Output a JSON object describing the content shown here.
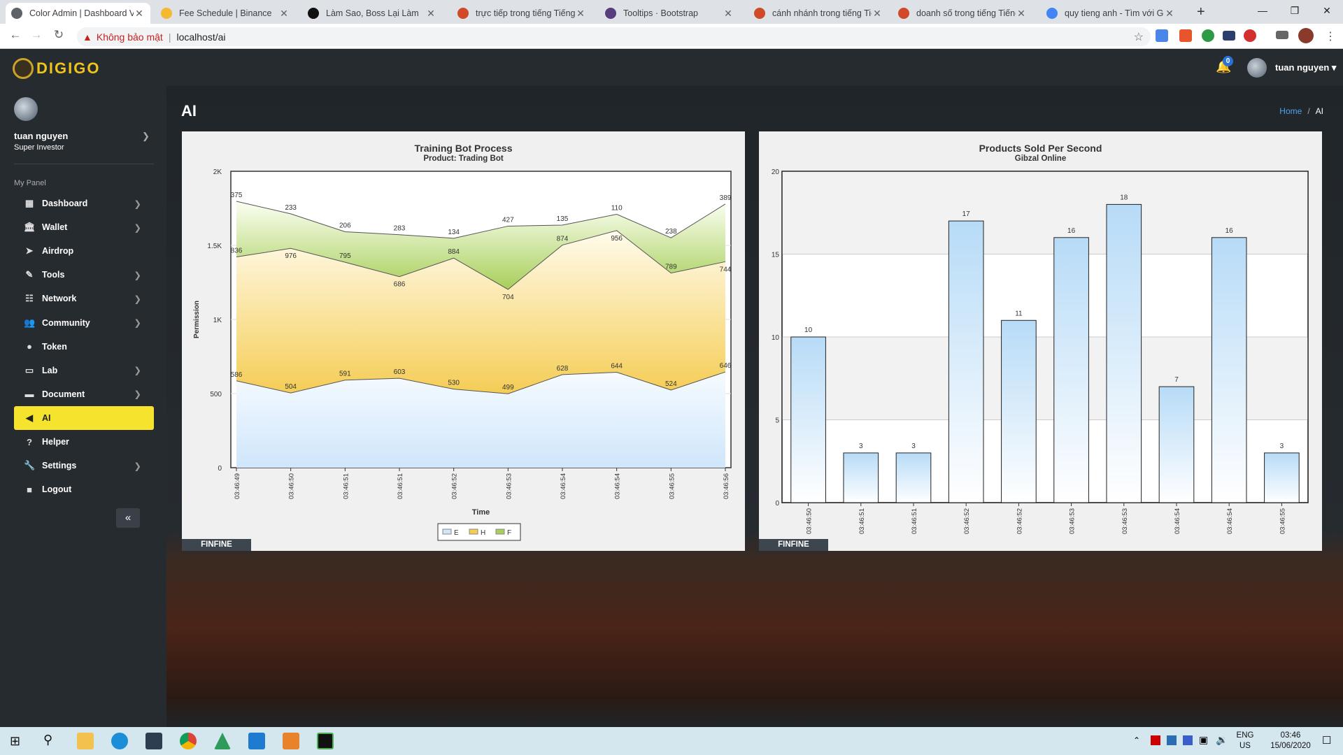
{
  "browser": {
    "tabs": [
      {
        "title": "Color Admin | Dashboard V",
        "active": true,
        "icon": "page-icon",
        "color": "#5f6368"
      },
      {
        "title": "Fee Schedule | Binance",
        "icon": "binance-icon",
        "color": "#f3ba2f"
      },
      {
        "title": "Làm Sao, Boss Lại Làm",
        "icon": "d-icon",
        "color": "#111111"
      },
      {
        "title": "trực tiếp trong tiếng Tiếng",
        "icon": "glosbe-icon",
        "color": "#d04a2a"
      },
      {
        "title": "Tooltips · Bootstrap",
        "icon": "bootstrap-icon",
        "color": "#563d7c"
      },
      {
        "title": "cánh nhánh trong tiếng Tiế",
        "icon": "glosbe-icon",
        "color": "#d04a2a"
      },
      {
        "title": "doanh số trong tiếng Tiếng",
        "icon": "glosbe-icon",
        "color": "#d04a2a"
      },
      {
        "title": "quy tieng anh - Tìm với Go",
        "icon": "google-icon",
        "color": "#4285f4"
      }
    ],
    "new_tab": "+",
    "security": "Không bảo mật",
    "url": "localhost/ai"
  },
  "app": {
    "brand": "DIGIGO",
    "notifications": "0",
    "user": "tuan nguyen ▾"
  },
  "sidebar": {
    "user_name": "tuan nguyen",
    "user_role": "Super Investor",
    "panel_label": "My Panel",
    "items": [
      {
        "label": "Dashboard",
        "icon": "grid-icon",
        "has_sub": true
      },
      {
        "label": "Wallet",
        "icon": "bank-icon",
        "has_sub": true
      },
      {
        "label": "Airdrop",
        "icon": "paper-plane-icon",
        "has_sub": false
      },
      {
        "label": "Tools",
        "icon": "pencil-icon",
        "has_sub": true
      },
      {
        "label": "Network",
        "icon": "sitemap-icon",
        "has_sub": true
      },
      {
        "label": "Community",
        "icon": "users-icon",
        "has_sub": true
      },
      {
        "label": "Token",
        "icon": "circle-icon",
        "has_sub": false
      },
      {
        "label": "Lab",
        "icon": "desktop-icon",
        "has_sub": true
      },
      {
        "label": "Document",
        "icon": "folder-icon",
        "has_sub": true
      },
      {
        "label": "AI",
        "icon": "horn-icon",
        "has_sub": false,
        "active": true
      },
      {
        "label": "Helper",
        "icon": "question-icon",
        "has_sub": false
      },
      {
        "label": "Settings",
        "icon": "wrench-icon",
        "has_sub": true
      },
      {
        "label": "Logout",
        "icon": "square-icon",
        "has_sub": false
      }
    ],
    "collapse": "«"
  },
  "page": {
    "title": "AI",
    "breadcrumb": [
      "Home",
      "/",
      "AI"
    ]
  },
  "panels": [
    {
      "footer": "FINFINE"
    },
    {
      "footer": "FINFINE"
    }
  ],
  "chart_data": [
    {
      "type": "area",
      "title": "Training Bot Process",
      "subtitle": "Product: Trading Bot",
      "xlabel": "Time",
      "ylabel": "Permission",
      "x": [
        "03:46:49",
        "03:46:50",
        "03:46:51",
        "03:46:51",
        "03:46:52",
        "03:46:53",
        "03:46:54",
        "03:46:54",
        "03:46:55",
        "03:46:56"
      ],
      "yticks": [
        "0",
        "500",
        "1K",
        "1.5K",
        "2K"
      ],
      "ylim": [
        0,
        2000
      ],
      "stacked": true,
      "series": [
        {
          "name": "E",
          "values": [
            586,
            504,
            591,
            603,
            530,
            499,
            628,
            644,
            524,
            646
          ],
          "color": "#cfe6fb"
        },
        {
          "name": "H",
          "values": [
            836,
            976,
            795,
            686,
            884,
            704,
            874,
            956,
            789,
            744
          ],
          "color": "#f5cd55"
        },
        {
          "name": "F",
          "values": [
            375,
            233,
            206,
            283,
            134,
            427,
            135,
            110,
            238,
            389
          ],
          "color": "#a8cf5a"
        }
      ],
      "legend": "bottom-center"
    },
    {
      "type": "bar",
      "title": "Products Sold Per Second",
      "subtitle": "Gibzal Online",
      "categories": [
        "03:46:50",
        "03:46:51",
        "03:46:51",
        "03:46:52",
        "03:46:52",
        "03:46:53",
        "03:46:53",
        "03:46:54",
        "03:46:54",
        "03:46:55"
      ],
      "values": [
        10,
        3,
        3,
        17,
        11,
        16,
        18,
        7,
        16,
        3
      ],
      "yticks": [
        "0",
        "5",
        "10",
        "15",
        "20"
      ],
      "ylim": [
        0,
        20
      ],
      "color": "#b7dbf7"
    }
  ],
  "taskbar": {
    "lang": [
      "ENG",
      "US"
    ],
    "time": "03:46",
    "date": "15/06/2020"
  }
}
